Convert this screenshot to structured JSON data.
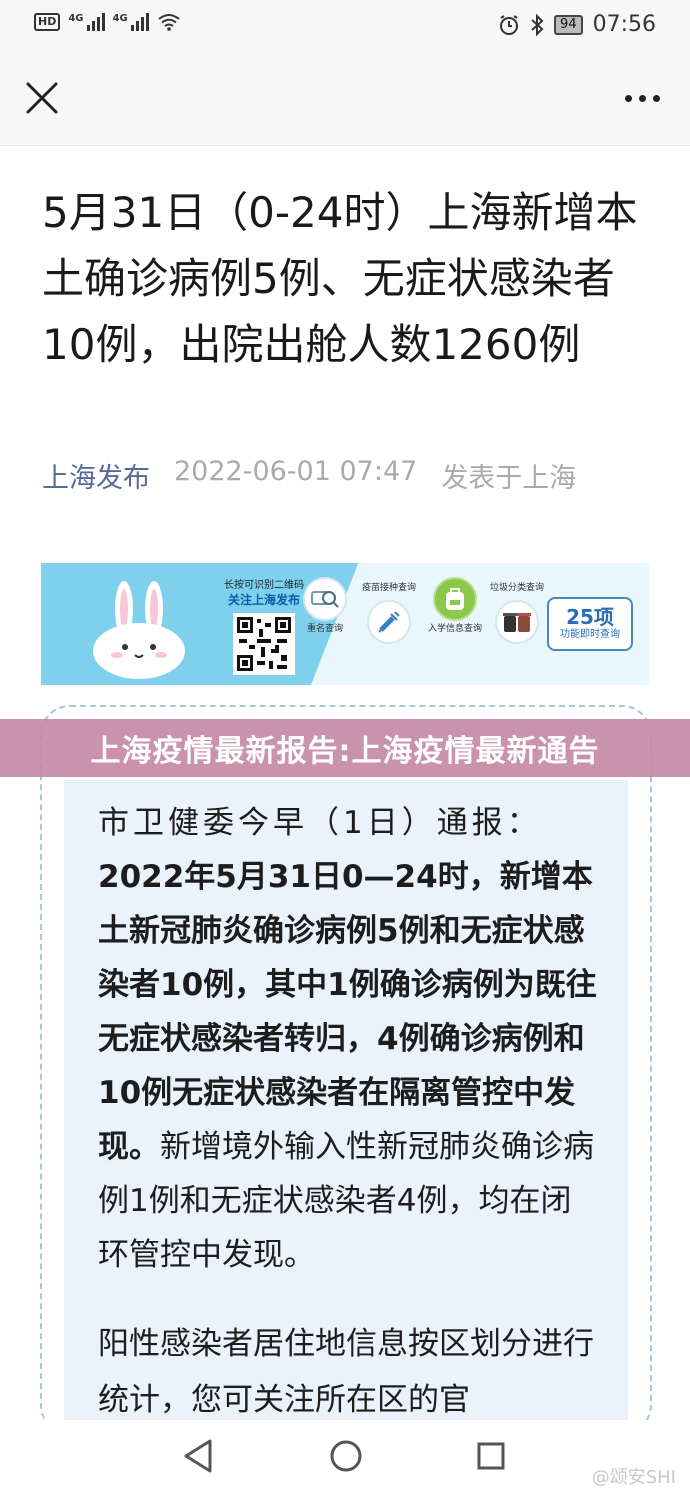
{
  "status_bar": {
    "hd": "HD",
    "net1": "4G",
    "net2": "4G",
    "battery": "94",
    "time": "07:56"
  },
  "topnav": {
    "close_icon": "close-icon",
    "more_icon": "more-icon"
  },
  "article": {
    "title": "5月31日（0-24时）上海新增本土确诊病例5例、无症状感染者10例，出院出舱人数1260例",
    "author": "上海发布",
    "datetime": "2022-06-01 07:47",
    "location": "发表于上海"
  },
  "banner": {
    "qr_line1": "长按可识别二维码",
    "qr_line2": "关注上海发布",
    "items": [
      {
        "label": "重名查询",
        "icon": "search-icon"
      },
      {
        "label": "疫苗接种查询",
        "icon": "syringe-icon"
      },
      {
        "label": "入学信息查询",
        "icon": "schoolbag-icon"
      },
      {
        "label": "垃圾分类查询",
        "icon": "trash-bin-icon"
      }
    ],
    "count": "25项",
    "count_sub": "功能即时查询"
  },
  "overlay": {
    "caption": "上海疫情最新报告:上海疫情最新通告"
  },
  "notice": {
    "intro": "市卫健委今早（1日）通报：",
    "bold": "2022年5月31日0—24时，新增本土新冠肺炎确诊病例5例和无症状感染者10例，其中1例确诊病例为既往无症状感染者转归，4例确诊病例和10例无症状感染者在隔离管控中发现。",
    "rest": "新增境外输入性新冠肺炎确诊病例1例和无症状感染者4例，均在闭环管控中发现。",
    "para2": "阳性感染者居住地信息按区划分进行统计，您可关注所在区的官"
  },
  "watermark": "@颂安SHI"
}
